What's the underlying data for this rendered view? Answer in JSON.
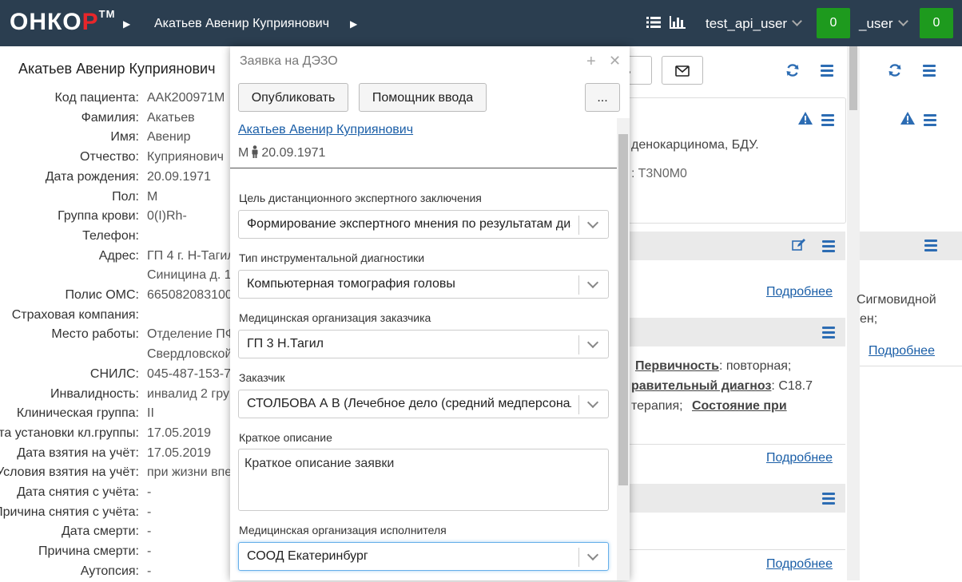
{
  "topbar": {
    "logo_main": "ОНКО",
    "logo_red": "Р",
    "logo_tm": "TM",
    "breadcrumb": "Акатьев Авенир Куприянович",
    "user1": "test_api_user",
    "counter1": "0",
    "user2": "_user",
    "counter2": "0"
  },
  "patient": {
    "name": "Акатьев Авенир Куприянович",
    "fields": [
      {
        "label": "Код пациента:",
        "value": "ААК200971М"
      },
      {
        "label": "Фамилия:",
        "value": "Акатьев"
      },
      {
        "label": "Имя:",
        "value": "Авенир"
      },
      {
        "label": "Отчество:",
        "value": "Куприянович"
      },
      {
        "label": "Дата рождения:",
        "value": "20.09.1971"
      },
      {
        "label": "Пол:",
        "value": "М"
      },
      {
        "label": "Группа крови:",
        "value": "0(I)Rh-"
      },
      {
        "label": "Телефон:",
        "value": ""
      },
      {
        "label": "Адрес:",
        "value": "ГП 4 г. Н-Тагил"
      },
      {
        "label": "",
        "value": "Синицина д. 1"
      },
      {
        "label": "Полис ОМС:",
        "value": "665082083100"
      },
      {
        "label": "Страховая компания:",
        "value": ""
      },
      {
        "label": "Место работы:",
        "value": "Отделение ПФ"
      },
      {
        "label": "",
        "value": "Свердловской"
      },
      {
        "label": "СНИЛС:",
        "value": "045-487-153-7"
      },
      {
        "label": "Инвалидность:",
        "value": "инвалид 2 гру"
      },
      {
        "label": "Клиническая группа:",
        "value": "II"
      },
      {
        "label": "Дата установки кл.группы:",
        "value": "17.05.2019"
      },
      {
        "label": "Дата взятия на учёт:",
        "value": "17.05.2019"
      },
      {
        "label": "Условия взятия на учёт:",
        "value": "при жизни впе"
      },
      {
        "label": "Дата снятия с учёта:",
        "value": "-"
      },
      {
        "label": "Причина снятия с учёта:",
        "value": "-"
      },
      {
        "label": "Дата смерти:",
        "value": "-"
      },
      {
        "label": "Причина смерти:",
        "value": "-"
      },
      {
        "label": "Аутопсия:",
        "value": "-"
      }
    ]
  },
  "background": {
    "button_partial": "ь",
    "diag_line1": "денокарцинома, БДУ.",
    "diag_line2": ": T3N0M0",
    "more": "Подробнее",
    "right_text1": "Сигмовидной",
    "right_text2": "ен;",
    "primary_label": "Первичность",
    "primary_value": ": повторная;",
    "diag_label": "равительный диагноз",
    "diag_value": ": C18.7",
    "therapy": "терапия;",
    "state_label": "Состояние при"
  },
  "modal": {
    "title": "Заявка на ДЭЗО",
    "publish": "Опубликовать",
    "helper": "Помощник ввода",
    "more": "...",
    "patient_link": "Акатьев Авенир Куприянович",
    "patient_sex": "М",
    "patient_dob": "20.09.1971",
    "fields": {
      "purpose_label": "Цель дистанционного экспертного заключения",
      "purpose_value": "Формирование экспертного мнения по результатам диагностики",
      "diag_type_label": "Тип инструментальной диагностики",
      "diag_type_value": "Компьютерная томография головы",
      "customer_org_label": "Медицинская организация заказчика",
      "customer_org_value": "ГП 3 Н.Тагил",
      "customer_label": "Заказчик",
      "customer_value": "СТОЛБОВА А В (Лечебное дело (средний медперсонал))",
      "desc_label": "Краткое описание",
      "desc_placeholder": "Краткое описание заявки",
      "executor_org_label": "Медицинская организация исполнителя",
      "executor_org_value": "СООД Екатеринбург"
    }
  }
}
